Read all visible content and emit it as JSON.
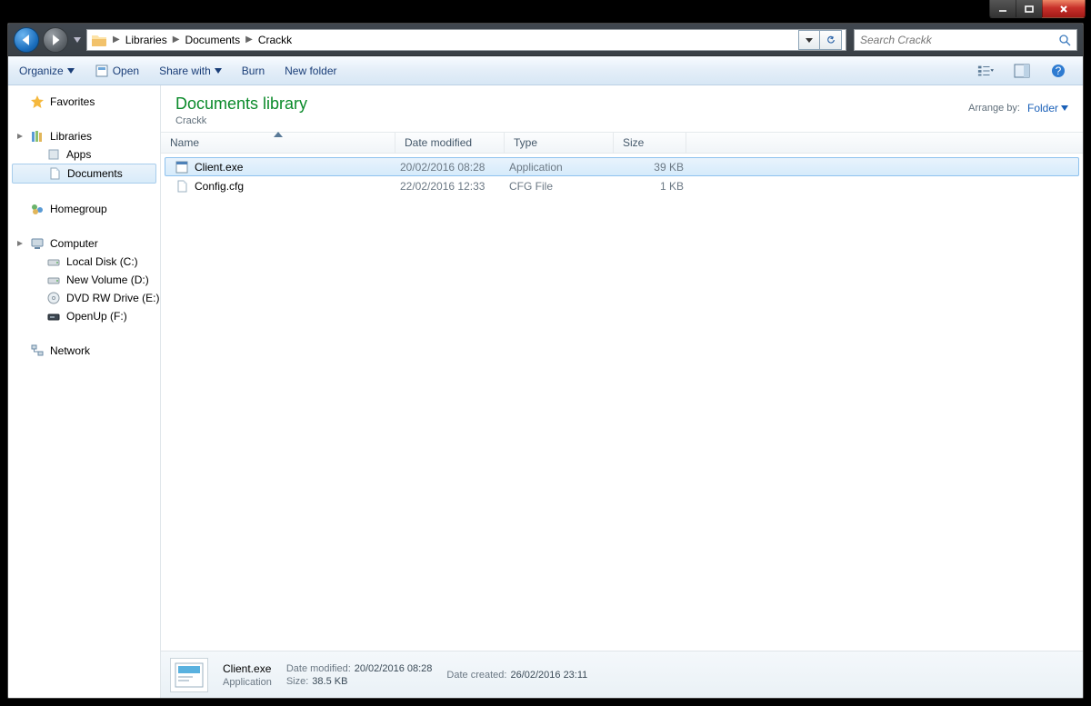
{
  "breadcrumbs": [
    "Libraries",
    "Documents",
    "Crackk"
  ],
  "search": {
    "placeholder": "Search Crackk"
  },
  "toolbar": {
    "organize": "Organize",
    "open": "Open",
    "share": "Share with",
    "burn": "Burn",
    "newfolder": "New folder"
  },
  "sidebar": {
    "favorites": "Favorites",
    "libraries": "Libraries",
    "lib_items": [
      "Apps",
      "Documents"
    ],
    "homegroup": "Homegroup",
    "computer": "Computer",
    "drives": [
      "Local Disk (C:)",
      "New Volume (D:)",
      "DVD RW Drive (E:) W",
      "OpenUp (F:)"
    ],
    "network": "Network"
  },
  "library": {
    "title": "Documents library",
    "subtitle": "Crackk",
    "arrange_label": "Arrange by:",
    "arrange_value": "Folder"
  },
  "columns": {
    "name": "Name",
    "date": "Date modified",
    "type": "Type",
    "size": "Size"
  },
  "files": [
    {
      "name": "Client.exe",
      "date": "20/02/2016 08:28",
      "type": "Application",
      "size": "39 KB",
      "selected": true,
      "icon": "app"
    },
    {
      "name": "Config.cfg",
      "date": "22/02/2016 12:33",
      "type": "CFG File",
      "size": "1 KB",
      "selected": false,
      "icon": "file"
    }
  ],
  "details": {
    "name": "Client.exe",
    "type": "Application",
    "modified_k": "Date modified:",
    "modified_v": "20/02/2016 08:28",
    "size_k": "Size:",
    "size_v": "38.5 KB",
    "created_k": "Date created:",
    "created_v": "26/02/2016 23:11"
  }
}
